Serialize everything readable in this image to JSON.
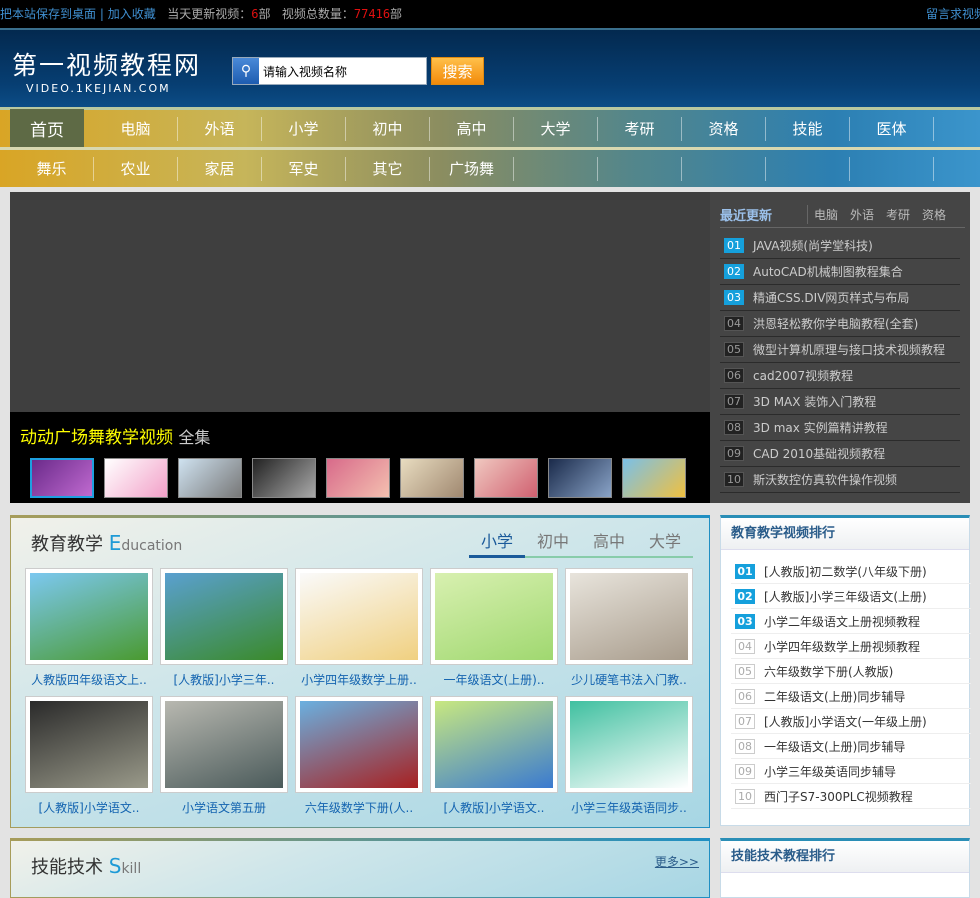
{
  "topbar": {
    "save_link": "把本站保存到桌面",
    "sep": "|",
    "fav_link": "加入收藏",
    "today_label": "当天更新视频：",
    "today_count": "6",
    "unit": "部",
    "total_label": "视频总数量：",
    "total_count": "77416",
    "unit2": "部",
    "request_link": "留言求视频"
  },
  "header": {
    "logo": "第一视频教程网",
    "logo_sub": "VIDEO.1KEJIAN.COM",
    "search_placeholder": "请输入视频名称",
    "search_button": "搜索"
  },
  "nav1": [
    "首页",
    "电脑",
    "外语",
    "小学",
    "初中",
    "高中",
    "大学",
    "考研",
    "资格",
    "技能",
    "医体"
  ],
  "nav2": [
    "舞乐",
    "农业",
    "家居",
    "军史",
    "其它",
    "广场舞",
    "",
    "",
    "",
    "",
    ""
  ],
  "slider": {
    "title": "动动广场舞教学视频",
    "suffix": "全集",
    "thumbs": [
      [
        "#6a2a8a",
        "#c06ad0"
      ],
      [
        "#fff",
        "#f2a0c8"
      ],
      [
        "#cfe2f0",
        "#777"
      ],
      [
        "#222",
        "#aaa"
      ],
      [
        "#d86a8a",
        "#f4c0b0"
      ],
      [
        "#e8dcc0",
        "#a08870"
      ],
      [
        "#f0c8c0",
        "#d06070"
      ],
      [
        "#1a2a4a",
        "#8aa4c8"
      ],
      [
        "#7ac0e8",
        "#f0c040"
      ]
    ]
  },
  "recent": {
    "title": "最近更新",
    "tabs": [
      "电脑",
      "外语",
      "考研",
      "资格"
    ],
    "items": [
      {
        "n": "01",
        "t": "JAVA视频(尚学堂科技)"
      },
      {
        "n": "02",
        "t": "AutoCAD机械制图教程集合"
      },
      {
        "n": "03",
        "t": "精通CSS.DIV网页样式与布局"
      },
      {
        "n": "04",
        "t": "洪恩轻松教你学电脑教程(全套)"
      },
      {
        "n": "05",
        "t": "微型计算机原理与接口技术视频教程"
      },
      {
        "n": "06",
        "t": "cad2007视频教程"
      },
      {
        "n": "07",
        "t": "3D MAX 装饰入门教程"
      },
      {
        "n": "08",
        "t": "3D max 实例篇精讲教程"
      },
      {
        "n": "09",
        "t": "CAD 2010基础视频教程"
      },
      {
        "n": "10",
        "t": "斯沃数控仿真软件操作视频"
      }
    ]
  },
  "edu": {
    "title": "教育教学",
    "en_initial": "E",
    "en_rest": "ducation",
    "tabs": [
      "小学",
      "初中",
      "高中",
      "大学"
    ],
    "items": [
      {
        "t": "人教版四年级语文上..",
        "c": [
          "#7cc8f0",
          "#4a9a30"
        ]
      },
      {
        "t": "[人教版]小学三年..",
        "c": [
          "#5aa0d0",
          "#3a8a2a"
        ]
      },
      {
        "t": "小学四年级数学上册..",
        "c": [
          "#fafafa",
          "#f0d080"
        ]
      },
      {
        "t": "一年级语文(上册)..",
        "c": [
          "#d8f0b0",
          "#a0d870"
        ]
      },
      {
        "t": "少儿硬笔书法入门教..",
        "c": [
          "#e8e4dc",
          "#a89c8c"
        ]
      },
      {
        "t": "[人教版]小学语文..",
        "c": [
          "#2a2a2a",
          "#9a9a8a"
        ]
      },
      {
        "t": "小学语文第五册",
        "c": [
          "#b8b8b0",
          "#4a5a5a"
        ]
      },
      {
        "t": "六年级数学下册(人..",
        "c": [
          "#6ab0e0",
          "#a82020"
        ]
      },
      {
        "t": "[人教版]小学语文..",
        "c": [
          "#c8e880",
          "#3a7ad0"
        ]
      },
      {
        "t": "小学三年级英语同步..",
        "c": [
          "#40c0a0",
          "#fff"
        ]
      }
    ]
  },
  "rank": {
    "title": "教育教学视频排行",
    "items": [
      {
        "n": "01",
        "t": "[人教版]初二数学(八年级下册)"
      },
      {
        "n": "02",
        "t": "[人教版]小学三年级语文(上册)"
      },
      {
        "n": "03",
        "t": "小学二年级语文上册视频教程"
      },
      {
        "n": "04",
        "t": "小学四年级数学上册视频教程"
      },
      {
        "n": "05",
        "t": "六年级数学下册(人教版)"
      },
      {
        "n": "06",
        "t": "二年级语文(上册)同步辅导"
      },
      {
        "n": "07",
        "t": "[人教版]小学语文(一年级上册)"
      },
      {
        "n": "08",
        "t": "一年级语文(上册)同步辅导"
      },
      {
        "n": "09",
        "t": "小学三年级英语同步辅导"
      },
      {
        "n": "10",
        "t": "西门子S7-300PLC视频教程"
      }
    ]
  },
  "skill": {
    "title": "技能技术",
    "en_initial": "S",
    "en_rest": "kill",
    "more": "更多>>"
  },
  "rank2": {
    "title": "技能技术教程排行"
  }
}
